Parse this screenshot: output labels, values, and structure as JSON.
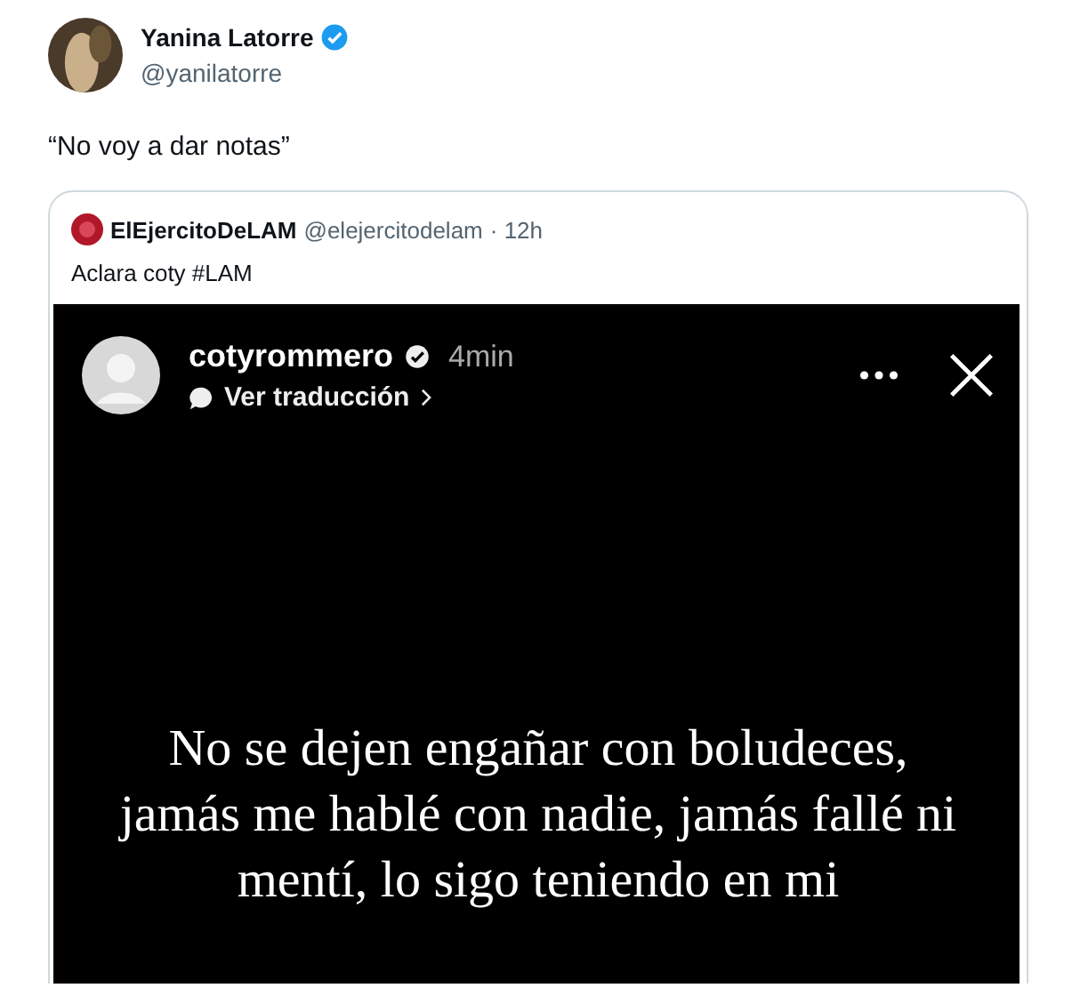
{
  "tweet": {
    "author": {
      "name": "Yanina Latorre",
      "handle": "@yanilatorre",
      "verified": true
    },
    "text": "“No voy a dar notas”",
    "quote": {
      "author": {
        "name": "ElEjercitoDeLAM",
        "handle": "@elejercitodelam",
        "time": "· 12h"
      },
      "text": "Aclara coty #LAM",
      "story": {
        "username": "cotyrommero",
        "verified": true,
        "time": "4min",
        "translate": "Ver traducción",
        "caption": "No se dejen engañar con boludeces, jamás me hablé con nadie, jamás fallé ni mentí, lo sigo teniendo en mi"
      }
    }
  }
}
